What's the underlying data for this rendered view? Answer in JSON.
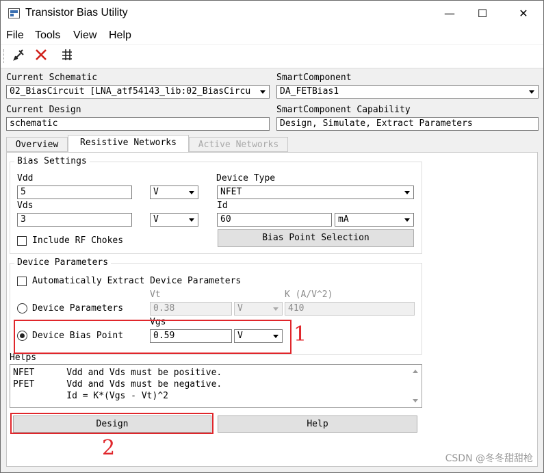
{
  "window": {
    "title": "Transistor Bias Utility",
    "controls": {
      "minimize": "—",
      "maximize": "☐",
      "close": "✕"
    }
  },
  "menubar": {
    "items": [
      "File",
      "Tools",
      "View",
      "Help"
    ]
  },
  "toolbar": {
    "icons": [
      "tune-icon",
      "delete-icon",
      "network-icon"
    ]
  },
  "schematic": {
    "current_schematic_label": "Current Schematic",
    "current_schematic_value": "02_BiasCircuit [LNA_atf54143_lib:02_BiasCircu",
    "smart_component_label": "SmartComponent",
    "smart_component_value": "DA_FETBias1",
    "current_design_label": "Current Design",
    "current_design_value": "schematic",
    "capability_label": "SmartComponent Capability",
    "capability_value": "Design, Simulate, Extract Parameters"
  },
  "tabs": [
    {
      "label": "Overview",
      "state": "normal"
    },
    {
      "label": "Resistive Networks",
      "state": "active"
    },
    {
      "label": "Active Networks",
      "state": "disabled"
    }
  ],
  "bias_settings": {
    "title": "Bias Settings",
    "vdd_label": "Vdd",
    "vdd_value": "5",
    "vdd_unit": "V",
    "vds_label": "Vds",
    "vds_value": "3",
    "vds_unit": "V",
    "device_type_label": "Device Type",
    "device_type_value": "NFET",
    "id_label": "Id",
    "id_value": "60",
    "id_unit": "mA",
    "include_rf_chokes_label": "Include RF Chokes",
    "include_rf_chokes_checked": false,
    "bias_point_button": "Bias Point Selection"
  },
  "device_parameters": {
    "title": "Device Parameters",
    "auto_extract_label": "Automatically Extract Device Parameters",
    "auto_extract_checked": false,
    "device_params_radio_label": "Device Parameters",
    "vt_label": "Vt",
    "vt_value": "0.38",
    "vt_unit": "V",
    "k_label": "K (A/V^2)",
    "k_value": "410",
    "device_bias_point_radio_label": "Device Bias Point",
    "vgs_label": "Vgs",
    "vgs_value": "0.59",
    "vgs_unit": "V",
    "selected_radio": "device_bias_point"
  },
  "helps": {
    "title": "Helps",
    "lines": [
      "NFET      Vdd and Vds must be positive.",
      "PFET      Vdd and Vds must be negative.",
      "          Id = K*(Vgs - Vt)^2"
    ]
  },
  "buttons": {
    "design": "Design",
    "help": "Help"
  },
  "annotations": {
    "marker_1": "1",
    "marker_2": "2",
    "color": "#e0262b"
  },
  "watermark": "CSDN @冬冬甜甜枪"
}
